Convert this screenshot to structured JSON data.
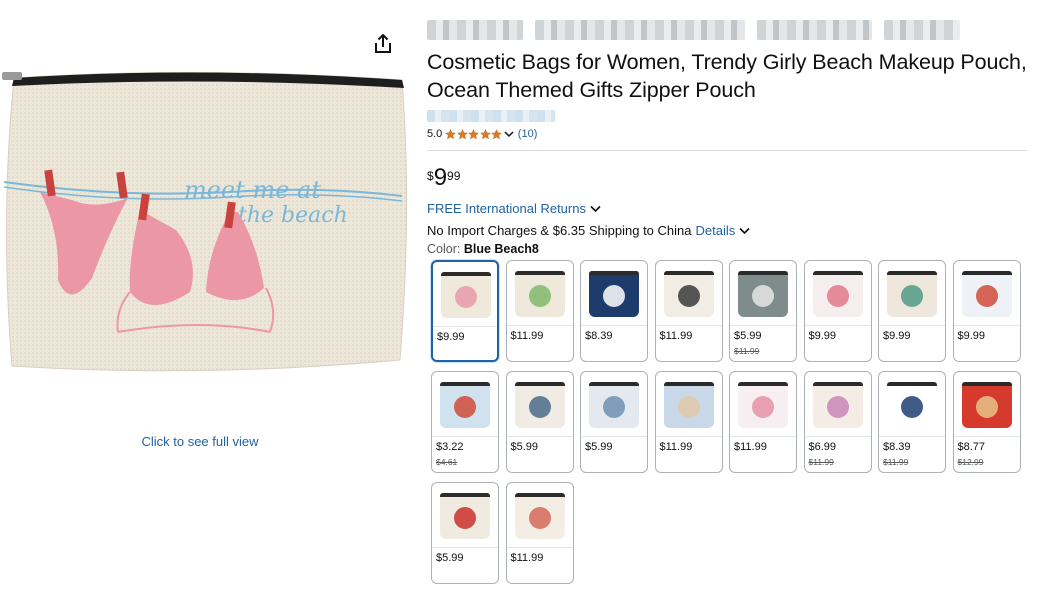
{
  "product": {
    "title": "Cosmetic Bags for Women, Trendy Girly Beach Makeup Pouch, Ocean Themed Gifts Zipper Pouch",
    "image_text_line1": "meet me at",
    "image_text_line2": "the beach",
    "full_view_link": "Click to see full view"
  },
  "rating": {
    "value": "5.0",
    "stars": 5,
    "count": "(10)"
  },
  "price": {
    "symbol": "$",
    "whole": "9",
    "fraction": "99"
  },
  "shipping": {
    "returns": "FREE International Returns",
    "import_text": "No Import Charges & $6.35 Shipping to China",
    "details_link": "Details"
  },
  "color": {
    "label": "Color:",
    "value": "Blue Beach8"
  },
  "swatches": [
    {
      "price": "$9.99",
      "original": "",
      "bg": "#efe9dc",
      "accent": "#e89aa8",
      "selected": true
    },
    {
      "price": "$11.99",
      "original": "",
      "bg": "#efe9dc",
      "accent": "#7fb86a",
      "selected": false
    },
    {
      "price": "$8.39",
      "original": "",
      "bg": "#1d3b6b",
      "accent": "#ffffff",
      "selected": false
    },
    {
      "price": "$11.99",
      "original": "",
      "bg": "#f1ede4",
      "accent": "#3a3a3a",
      "selected": false
    },
    {
      "price": "$5.99",
      "original": "$11.99",
      "bg": "#7e8c8c",
      "accent": "#e6e6e6",
      "selected": false
    },
    {
      "price": "$9.99",
      "original": "",
      "bg": "#f4eeee",
      "accent": "#e27887",
      "selected": false
    },
    {
      "price": "$9.99",
      "original": "",
      "bg": "#efe7dc",
      "accent": "#4f9a86",
      "selected": false
    },
    {
      "price": "$9.99",
      "original": "",
      "bg": "#eef1f5",
      "accent": "#d04a3a",
      "selected": false
    },
    {
      "price": "$3.22",
      "original": "$4.61",
      "bg": "#cfe2ee",
      "accent": "#d04a3a",
      "selected": false
    },
    {
      "price": "$5.99",
      "original": "",
      "bg": "#f0ece3",
      "accent": "#4a6b8a",
      "selected": false
    },
    {
      "price": "$5.99",
      "original": "",
      "bg": "#e3e9ef",
      "accent": "#6f8fb0",
      "selected": false
    },
    {
      "price": "$11.99",
      "original": "",
      "bg": "#c8d8e8",
      "accent": "#e0c9a8",
      "selected": false
    },
    {
      "price": "$11.99",
      "original": "",
      "bg": "#f6eef0",
      "accent": "#e592a5",
      "selected": false
    },
    {
      "price": "$6.99",
      "original": "$11.99",
      "bg": "#f3ede6",
      "accent": "#c984b8",
      "selected": false
    },
    {
      "price": "$8.39",
      "original": "$11.99",
      "bg": "#ffffff",
      "accent": "#203e74",
      "selected": false
    },
    {
      "price": "$8.77",
      "original": "$12.99",
      "bg": "#d63a2c",
      "accent": "#e8c48a",
      "selected": false
    },
    {
      "price": "$5.99",
      "original": "",
      "bg": "#f0ebe0",
      "accent": "#c9302c",
      "selected": false
    },
    {
      "price": "$11.99",
      "original": "",
      "bg": "#f3ede4",
      "accent": "#d46a5a",
      "selected": false
    }
  ],
  "icons": {
    "share": "share-icon",
    "star": "star-icon",
    "chevron": "chevron-down-icon"
  },
  "colors": {
    "link": "#2162a1",
    "star": "#de7921",
    "selected_border": "#2162a1"
  }
}
